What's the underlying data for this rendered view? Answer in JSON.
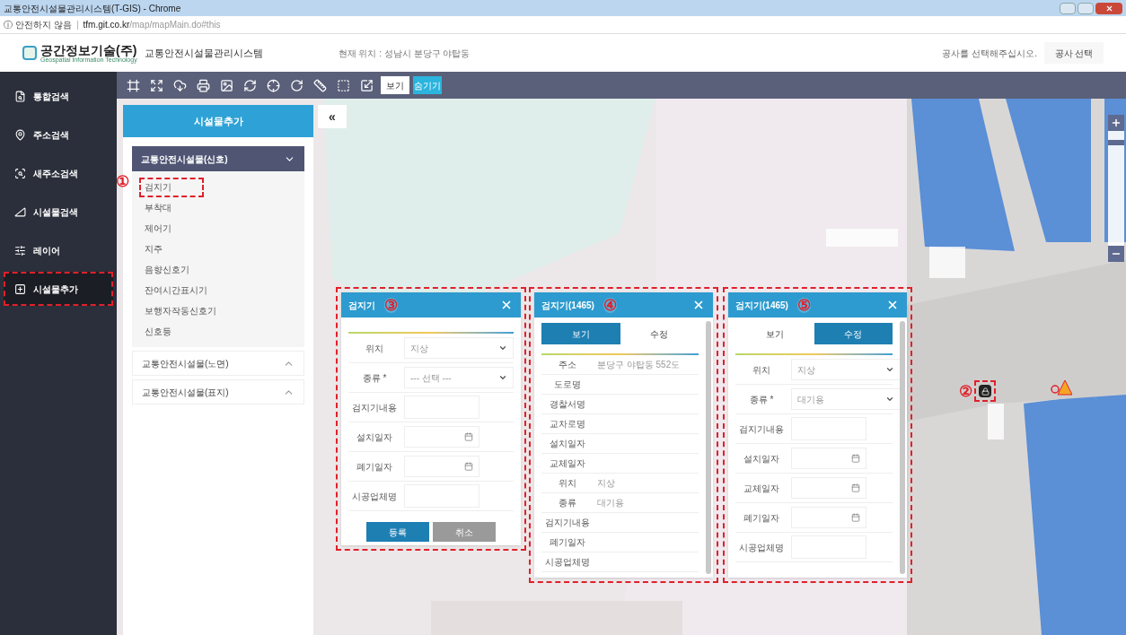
{
  "browser": {
    "title": "교통안전시설물관리시스템(T-GIS) - Chrome",
    "security": "ⓘ 안전하지 않음",
    "url_host": "tfm.git.co.kr",
    "url_path": "/map/mapMain.do#this"
  },
  "header": {
    "logo": "공간정보기술(주)",
    "logo_sub": "Geospatial Information Technology",
    "system_name": "교통안전시설물관리시스템",
    "location": "현재 위치 : 성남시 분당구 야탑동",
    "prompt": "공사를 선택해주십시오.",
    "select_button": "공사 선택"
  },
  "sidebar": {
    "items": [
      {
        "label": "통합검색",
        "selected": false,
        "outlined": false
      },
      {
        "label": "주소검색",
        "selected": false,
        "outlined": false
      },
      {
        "label": "새주소검색",
        "selected": false,
        "outlined": false
      },
      {
        "label": "시설물검색",
        "selected": false,
        "outlined": false
      },
      {
        "label": "레이어",
        "selected": false,
        "outlined": false
      },
      {
        "label": "시설물추가",
        "selected": true,
        "outlined": true
      }
    ]
  },
  "toolbar": {
    "toggles": [
      {
        "label": "보기",
        "selected": false
      },
      {
        "label": "숨기기",
        "selected": true
      }
    ]
  },
  "panel": {
    "title": "시설물추가",
    "collapse": "«",
    "groups": [
      {
        "title": "교통안전시설물(신호)",
        "expanded": true,
        "items": [
          {
            "label": "검지기",
            "outlined": true,
            "callout": "①"
          },
          {
            "label": "부착대",
            "outlined": false
          },
          {
            "label": "제어기",
            "outlined": false
          },
          {
            "label": "지주",
            "outlined": false
          },
          {
            "label": "음향신호기",
            "outlined": false
          },
          {
            "label": "잔여시간표시기",
            "outlined": false
          },
          {
            "label": "보행자작동신호기",
            "outlined": false
          },
          {
            "label": "신호등",
            "outlined": false
          }
        ]
      },
      {
        "title": "교통안전시설물(노면)",
        "expanded": false
      },
      {
        "title": "교통안전시설물(표지)",
        "expanded": false
      }
    ]
  },
  "dialogs": [
    {
      "title": "검지기",
      "callout": "③",
      "outlined": true,
      "fields": [
        {
          "label": "위치",
          "kind": "select",
          "value": "지상"
        },
        {
          "label": "종류 *",
          "kind": "select",
          "value": "--- 선택 ---"
        },
        {
          "label": "검지기내용",
          "kind": "text"
        },
        {
          "label": "설치일자",
          "kind": "date"
        },
        {
          "label": "폐기일자",
          "kind": "date"
        },
        {
          "label": "시공업체명",
          "kind": "text"
        }
      ],
      "buttons": [
        {
          "label": "등록",
          "kind": "primary"
        },
        {
          "label": "취소",
          "kind": "secondary"
        }
      ]
    },
    {
      "title": "검지기(1465)",
      "callout": "④",
      "outlined": true,
      "tabs": [
        {
          "label": "보기",
          "selected": true
        },
        {
          "label": "수정",
          "selected": false
        }
      ],
      "fields": [
        {
          "label": "주소",
          "kind": "readonly",
          "value": "분당구 야탑동 552도"
        },
        {
          "label": "도로명",
          "kind": "readonly"
        },
        {
          "label": "경찰서명",
          "kind": "readonly"
        },
        {
          "label": "교차로명",
          "kind": "readonly"
        },
        {
          "label": "설치일자",
          "kind": "readonly"
        },
        {
          "label": "교체일자",
          "kind": "readonly"
        },
        {
          "label": "위치",
          "kind": "readonly",
          "value": "지상"
        },
        {
          "label": "종류",
          "kind": "readonly",
          "value": "대기용"
        },
        {
          "label": "검지기내용",
          "kind": "readonly"
        },
        {
          "label": "폐기일자",
          "kind": "readonly"
        },
        {
          "label": "시공업체명",
          "kind": "readonly"
        }
      ]
    },
    {
      "title": "검지기(1465)",
      "callout": "⑤",
      "outlined": true,
      "tabs": [
        {
          "label": "보기",
          "selected": false
        },
        {
          "label": "수정",
          "selected": true
        }
      ],
      "fields": [
        {
          "label": "위치",
          "kind": "select",
          "value": "지상"
        },
        {
          "label": "종류 *",
          "kind": "select",
          "value": "대기용"
        },
        {
          "label": "검지기내용",
          "kind": "text"
        },
        {
          "label": "설치일자",
          "kind": "date"
        },
        {
          "label": "교체일자",
          "kind": "date"
        },
        {
          "label": "폐기일자",
          "kind": "date"
        },
        {
          "label": "시공업체명",
          "kind": "text"
        }
      ]
    }
  ],
  "map": {
    "marker": {
      "callout": "②",
      "outlined": true
    },
    "zoom": {
      "level": 0.92
    }
  }
}
